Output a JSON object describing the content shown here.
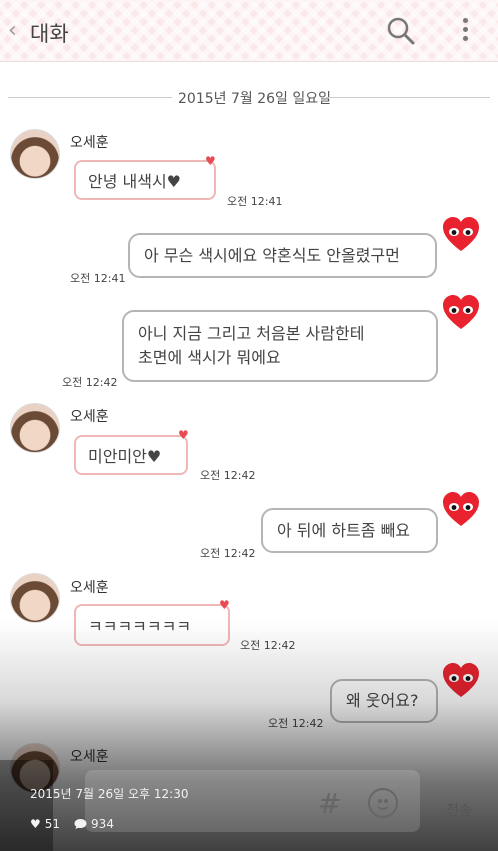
{
  "header": {
    "back": "‹",
    "title": "대화"
  },
  "date_divider": "2015년 7월 26일 일요일",
  "sender_name": "오세훈",
  "messages": [
    {
      "type": "in",
      "text": "안녕 내색시♥",
      "time": "오전 12:41"
    },
    {
      "type": "out",
      "text": "아 무슨 색시에요 약혼식도 안올렸구먼",
      "time": "오전 12:41"
    },
    {
      "type": "out",
      "text": "아니 지금 그리고 처음본 사람한테\n초면에 색시가 뭐에요",
      "time": "오전 12:42"
    },
    {
      "type": "in",
      "text": "미안미안♥",
      "time": "오전 12:42"
    },
    {
      "type": "out",
      "text": "아 뒤에 하트좀 빼요",
      "time": "오전 12:42"
    },
    {
      "type": "in",
      "text": "ㅋㅋㅋㅋㅋㅋㅋ",
      "time": "오전 12:42"
    },
    {
      "type": "out",
      "text": "왜 웃어요?",
      "time": "오전 12:42"
    }
  ],
  "input": {
    "hash": "#",
    "send": "전송"
  },
  "post": {
    "date": "2015년 7월 26일 오후 12:30",
    "likes": "51",
    "comments": "934"
  },
  "colors": {
    "heart": "#e8232f",
    "incoming_border": "#f0b7b7",
    "outgoing_border": "#b5b5b5"
  }
}
